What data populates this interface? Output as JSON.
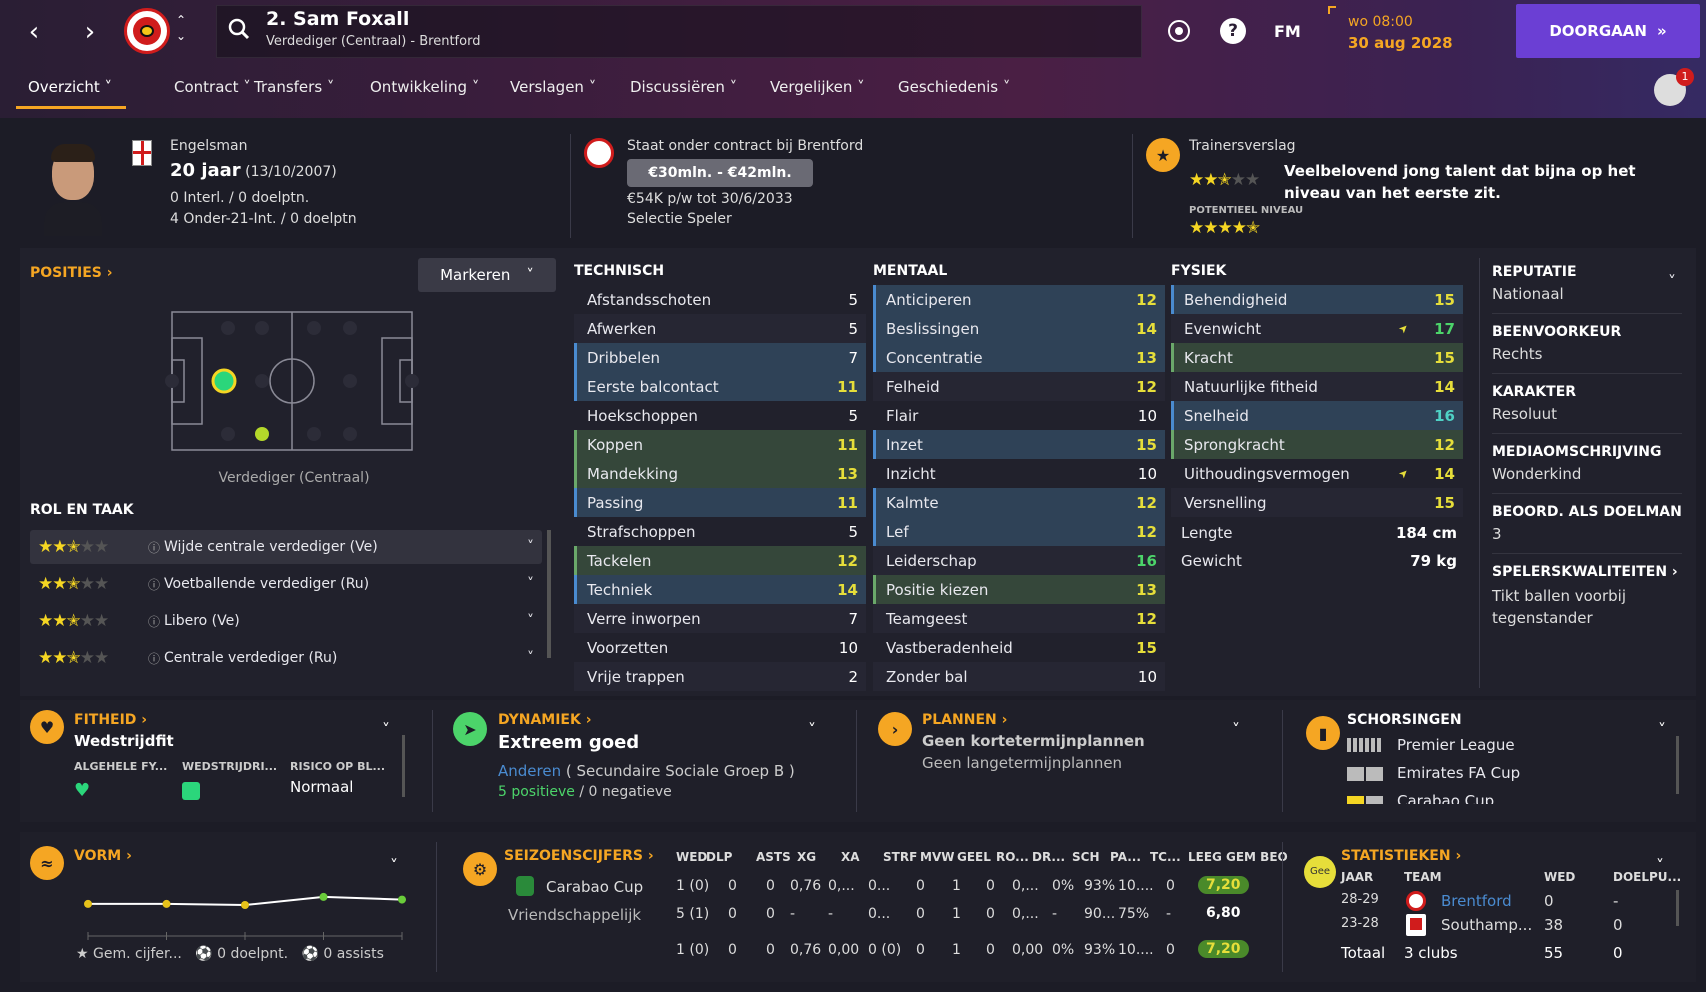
{
  "header": {
    "player_name": "2. Sam Foxall",
    "player_sub": "Verdediger (Centraal) - Brentford",
    "fm_label": "FM",
    "time": "wo 08:00",
    "date": "30 aug 2028",
    "continue_label": "DOORGAAN",
    "notification_count": "1"
  },
  "tabs": [
    "Overzicht",
    "Contract",
    "Transfers",
    "Ontwikkeling",
    "Verslagen",
    "Discussiëren",
    "Vergelijken",
    "Geschiedenis"
  ],
  "profile": {
    "nationality": "Engelsman",
    "age": "20 jaar",
    "dob": "(13/10/2007)",
    "caps": "0 Interl. / 0 doelptn.",
    "u21": "4 Onder-21-Int. / 0 doelptn",
    "contract_club": "Staat onder contract bij Brentford",
    "value": "€30mln. - €42mln.",
    "wage": "€54K p/w tot 30/6/2033",
    "squad_status": "Selectie Speler",
    "report_title": "Trainersverslag",
    "report_text": "Veelbelovend jong talent dat bijna op het niveau van het eerste zit.",
    "potential_label": "POTENTIEEL NIVEAU",
    "current_stars": 2.5,
    "potential_stars": 4.5
  },
  "positions": {
    "title": "POSITIES",
    "mark_btn": "Markeren",
    "position_label": "Verdediger (Centraal)",
    "role_title": "ROL EN TAAK",
    "roles": [
      {
        "name": "Wijde centrale verdediger (Ve)",
        "stars": 2.5
      },
      {
        "name": "Voetballende verdediger (Ru)",
        "stars": 2.5
      },
      {
        "name": "Libero (Ve)",
        "stars": 2.5
      },
      {
        "name": "Centrale verdediger (Ru)",
        "stars": 2.5
      }
    ]
  },
  "technical": {
    "title": "TECHNISCH",
    "rows": [
      {
        "name": "Afstandsschoten",
        "value": "5",
        "hl": "none",
        "c": "w"
      },
      {
        "name": "Afwerken",
        "value": "5",
        "hl": "none",
        "c": "w"
      },
      {
        "name": "Dribbelen",
        "value": "7",
        "hl": "blue",
        "c": "w"
      },
      {
        "name": "Eerste balcontact",
        "value": "11",
        "hl": "blue",
        "c": "y"
      },
      {
        "name": "Hoekschoppen",
        "value": "5",
        "hl": "none",
        "c": "w"
      },
      {
        "name": "Koppen",
        "value": "11",
        "hl": "green",
        "c": "y"
      },
      {
        "name": "Mandekking",
        "value": "13",
        "hl": "green",
        "c": "y"
      },
      {
        "name": "Passing",
        "value": "11",
        "hl": "blue",
        "c": "y"
      },
      {
        "name": "Strafschoppen",
        "value": "5",
        "hl": "none",
        "c": "w"
      },
      {
        "name": "Tackelen",
        "value": "12",
        "hl": "green",
        "c": "y"
      },
      {
        "name": "Techniek",
        "value": "14",
        "hl": "blue",
        "c": "y"
      },
      {
        "name": "Verre inworpen",
        "value": "7",
        "hl": "none",
        "c": "w"
      },
      {
        "name": "Voorzetten",
        "value": "10",
        "hl": "none",
        "c": "w"
      },
      {
        "name": "Vrije trappen",
        "value": "2",
        "hl": "none",
        "c": "w"
      }
    ]
  },
  "mental": {
    "title": "MENTAAL",
    "rows": [
      {
        "name": "Anticiperen",
        "value": "12",
        "hl": "blue",
        "c": "y"
      },
      {
        "name": "Beslissingen",
        "value": "14",
        "hl": "blue",
        "c": "y"
      },
      {
        "name": "Concentratie",
        "value": "13",
        "hl": "blue",
        "c": "y"
      },
      {
        "name": "Felheid",
        "value": "12",
        "hl": "none",
        "c": "y"
      },
      {
        "name": "Flair",
        "value": "10",
        "hl": "none",
        "c": "w"
      },
      {
        "name": "Inzet",
        "value": "15",
        "hl": "blue",
        "c": "y"
      },
      {
        "name": "Inzicht",
        "value": "10",
        "hl": "none",
        "c": "w"
      },
      {
        "name": "Kalmte",
        "value": "12",
        "hl": "blue",
        "c": "y"
      },
      {
        "name": "Lef",
        "value": "12",
        "hl": "blue",
        "c": "y"
      },
      {
        "name": "Leiderschap",
        "value": "16",
        "hl": "none",
        "c": "g"
      },
      {
        "name": "Positie kiezen",
        "value": "13",
        "hl": "green",
        "c": "y"
      },
      {
        "name": "Teamgeest",
        "value": "12",
        "hl": "none",
        "c": "y"
      },
      {
        "name": "Vastberadenheid",
        "value": "15",
        "hl": "none",
        "c": "y"
      },
      {
        "name": "Zonder bal",
        "value": "10",
        "hl": "none",
        "c": "w"
      }
    ]
  },
  "physical": {
    "title": "FYSIEK",
    "rows": [
      {
        "name": "Behendigheid",
        "value": "15",
        "hl": "blue",
        "c": "y"
      },
      {
        "name": "Evenwicht",
        "value": "17",
        "hl": "none",
        "c": "g",
        "arrow": true
      },
      {
        "name": "Kracht",
        "value": "15",
        "hl": "green",
        "c": "y"
      },
      {
        "name": "Natuurlijke fitheid",
        "value": "14",
        "hl": "none",
        "c": "y"
      },
      {
        "name": "Snelheid",
        "value": "16",
        "hl": "blue",
        "c": "c"
      },
      {
        "name": "Sprongkracht",
        "value": "12",
        "hl": "green",
        "c": "y"
      },
      {
        "name": "Uithoudingsvermogen",
        "value": "14",
        "hl": "none",
        "c": "y",
        "arrow": true
      },
      {
        "name": "Versnelling",
        "value": "15",
        "hl": "none",
        "c": "y"
      }
    ],
    "height_label": "Lengte",
    "height": "184 cm",
    "weight_label": "Gewicht",
    "weight": "79 kg"
  },
  "info": [
    {
      "label": "REPUTATIE",
      "value": "Nationaal"
    },
    {
      "label": "BEENVOORKEUR",
      "value": "Rechts"
    },
    {
      "label": "KARAKTER",
      "value": "Resoluut"
    },
    {
      "label": "MEDIAOMSCHRIJVING",
      "value": "Wonderkind"
    },
    {
      "label": "BEOORD. ALS DOELMAN",
      "value": "3"
    },
    {
      "label": "SPELERSKWALITEITEN",
      "value": "Tikt ballen voorbij tegenstander"
    }
  ],
  "fitness": {
    "title": "FITHEID",
    "status": "Wedstrijdfit",
    "c1": "ALGEHELE FY...",
    "c2": "WEDSTRIJDRI...",
    "c3": "RISICO OP BL...",
    "risk": "Normaal"
  },
  "dynamics": {
    "title": "DYNAMIEK",
    "status": "Extreem goed",
    "group_link": "Anderen",
    "group": "( Secundaire Sociale Groep B )",
    "positive": "5 positieve",
    "sep": "/",
    "negative": "0 negatieve"
  },
  "plans": {
    "title": "PLANNEN",
    "short": "Geen kortetermijnplannen",
    "long": "Geen langetermijnplannen"
  },
  "suspensions": {
    "title": "SCHORSINGEN",
    "items": [
      "Premier League",
      "Emirates FA Cup",
      "Carabao Cup"
    ]
  },
  "form": {
    "title": "VORM",
    "avg": "Gem. cijfer...",
    "goals": "0 doelpnt.",
    "assists": "0 assists",
    "values": [
      0.52,
      0.52,
      0.5,
      0.65,
      0.6
    ]
  },
  "season": {
    "title": "SEIZOENSCIJFERS",
    "headers": [
      "WED",
      "DLP",
      "ASTS",
      "XG",
      "XA",
      "STRF",
      "MVW",
      "GEEL",
      "RO...",
      "DR...",
      "SCH",
      "PA...",
      "TC...",
      "LEEG",
      "GEM BEO"
    ],
    "rows": [
      {
        "comp": "Carabao Cup",
        "cells": [
          "1 (0)",
          "0",
          "0",
          "0,76",
          "0,...",
          "0...",
          "0",
          "1",
          "0",
          "0,...",
          "0%",
          "93%",
          "10....",
          "0"
        ],
        "rating": "7,20",
        "hi": true
      },
      {
        "comp": "Vriendschappelijk",
        "cells": [
          "5 (1)",
          "0",
          "0",
          "-",
          "-",
          "0...",
          "0",
          "1",
          "0",
          "0,...",
          "-",
          "90...",
          "75%",
          "-"
        ],
        "rating": "6,80",
        "hi": false
      },
      {
        "comp": "",
        "cells": [
          "1 (0)",
          "0",
          "0",
          "0,76",
          "0,00",
          "0 (0)",
          "0",
          "1",
          "0",
          "0,00",
          "0%",
          "93%",
          "10....",
          "0"
        ],
        "rating": "7,20",
        "hi": true
      }
    ]
  },
  "stats": {
    "title": "STATISTIEKEN",
    "badge": "Gee",
    "headers": [
      "JAAR",
      "TEAM",
      "WED",
      "DOELPU..."
    ],
    "rows": [
      {
        "year": "28-29",
        "team": "Brentford",
        "apps": "0",
        "goals": "-"
      },
      {
        "year": "23-28",
        "team": "Southamp...",
        "apps": "38",
        "goals": "0"
      }
    ],
    "total_label": "Totaal",
    "total_team": "3 clubs",
    "total_apps": "55",
    "total_goals": "0"
  }
}
